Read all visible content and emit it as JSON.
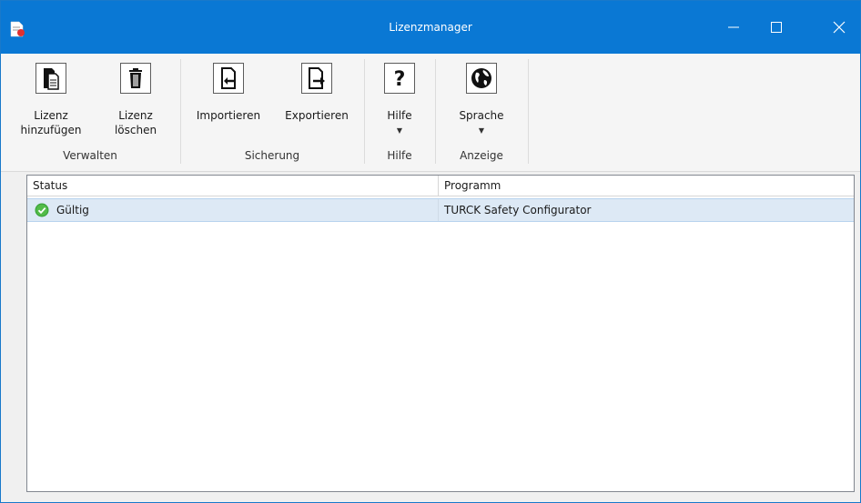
{
  "window": {
    "title": "Lizenzmanager"
  },
  "ribbon": {
    "groups": [
      {
        "label": "Verwalten",
        "buttons": [
          {
            "label": "Lizenz\nhinzufügen",
            "icon": "add-license-icon"
          },
          {
            "label": "Lizenz\nlöschen",
            "icon": "trash-icon"
          }
        ]
      },
      {
        "label": "Sicherung",
        "buttons": [
          {
            "label": "Importieren",
            "icon": "import-icon"
          },
          {
            "label": "Exportieren",
            "icon": "export-icon"
          }
        ]
      },
      {
        "label": "Hilfe",
        "buttons": [
          {
            "label": "Hilfe",
            "icon": "question-icon",
            "dropdown": "▼"
          }
        ]
      },
      {
        "label": "Anzeige",
        "buttons": [
          {
            "label": "Sprache",
            "icon": "globe-icon",
            "dropdown": "▼"
          }
        ]
      }
    ]
  },
  "table": {
    "columns": [
      "Status",
      "Programm"
    ],
    "rows": [
      {
        "status": "Gültig",
        "program": "TURCK Safety Configurator",
        "status_color": "#3aa33a"
      }
    ]
  },
  "colors": {
    "titlebar": "#0a78d4",
    "selected_row": "#dde9f5"
  }
}
